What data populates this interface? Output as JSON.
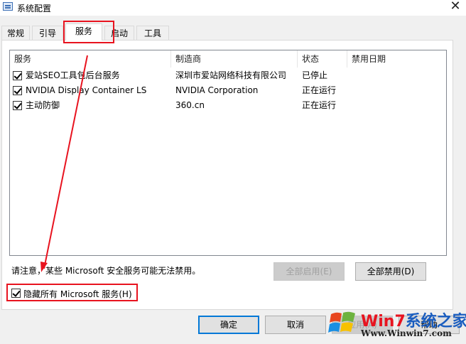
{
  "window": {
    "title": "系统配置",
    "close_glyph": "✕"
  },
  "tabs": [
    {
      "label": "常规"
    },
    {
      "label": "引导"
    },
    {
      "label": "服务"
    },
    {
      "label": "启动"
    },
    {
      "label": "工具"
    }
  ],
  "active_tab": "服务",
  "services_table": {
    "columns": [
      "服务",
      "制造商",
      "状态",
      "禁用日期"
    ],
    "rows": [
      {
        "checked": true,
        "service": "爱站SEO工具包后台服务",
        "manufacturer": "深圳市爱站网络科技有限公司",
        "status": "已停止",
        "disabled_date": ""
      },
      {
        "checked": true,
        "service": "NVIDIA Display Container LS",
        "manufacturer": "NVIDIA Corporation",
        "status": "正在运行",
        "disabled_date": ""
      },
      {
        "checked": true,
        "service": "主动防御",
        "manufacturer": "360.cn",
        "status": "正在运行",
        "disabled_date": ""
      }
    ]
  },
  "note": "请注意，某些 Microsoft 安全服务可能无法禁用。",
  "buttons": {
    "enable_all": "全部启用(E)",
    "disable_all": "全部禁用(D)",
    "ok": "确定",
    "cancel": "取消",
    "apply": "应用(A)",
    "help": "帮助"
  },
  "hide_ms": {
    "checked": true,
    "label": "隐藏所有 Microsoft 服务(H)"
  },
  "watermark": {
    "brand_prefix": "Win7",
    "brand_suffix": "系统之家",
    "url": "Www.Winwin7.com"
  },
  "colors": {
    "annotation_red": "#e8131f",
    "accent_blue": "#0078d7",
    "window_bg": "#f0f0f0"
  }
}
